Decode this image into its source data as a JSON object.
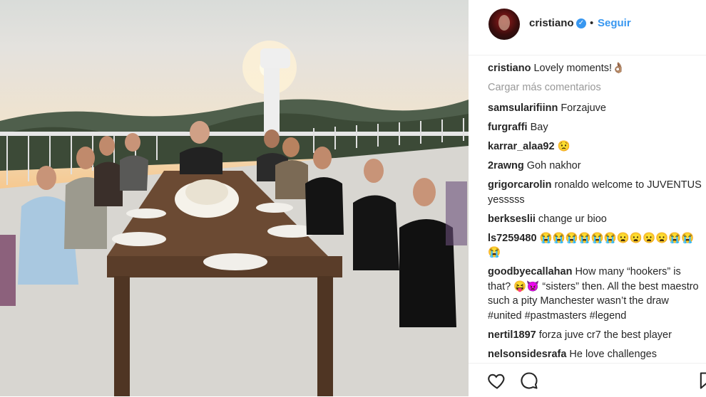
{
  "post": {
    "username": "cristiano",
    "follow_label": "Seguir",
    "separator": "•"
  },
  "caption": {
    "username": "cristiano",
    "text": "Lovely moments!👌🏽"
  },
  "load_more_label": "Cargar más comentarios",
  "comments": [
    {
      "username": "samsularifiinn",
      "text": "Forzajuve"
    },
    {
      "username": "furgraffi",
      "text": "Bay"
    },
    {
      "username": "karrar_alaa92",
      "text": "😟"
    },
    {
      "username": "2rawng",
      "text": "Goh nakhor"
    },
    {
      "username": "grigorcarolin",
      "text": "ronaldo welcome to JUVENTUS yesssss"
    },
    {
      "username": "berkseslii",
      "text": "change ur bioo"
    },
    {
      "username": "ls7259480",
      "text": "😭😭😭😭😭😭😦😦😦😦😭😭😭"
    },
    {
      "username": "goodbyecallahan",
      "text": "How many “hookers” is that? 😝👿 “sisters” then. All the best maestro such a pity Manchester wasn’t the draw #united #pastmasters #legend"
    },
    {
      "username": "nertil1897",
      "text": "forza juve cr7 the best player"
    },
    {
      "username": "nelsonsidesrafa",
      "text": "He love challenges"
    }
  ],
  "icons": {
    "like": "heart-icon",
    "comment": "comment-icon",
    "save": "bookmark-icon",
    "verified": "verified-badge-icon"
  },
  "colors": {
    "accent": "#3897f0",
    "muted": "#999999",
    "text": "#262626"
  }
}
